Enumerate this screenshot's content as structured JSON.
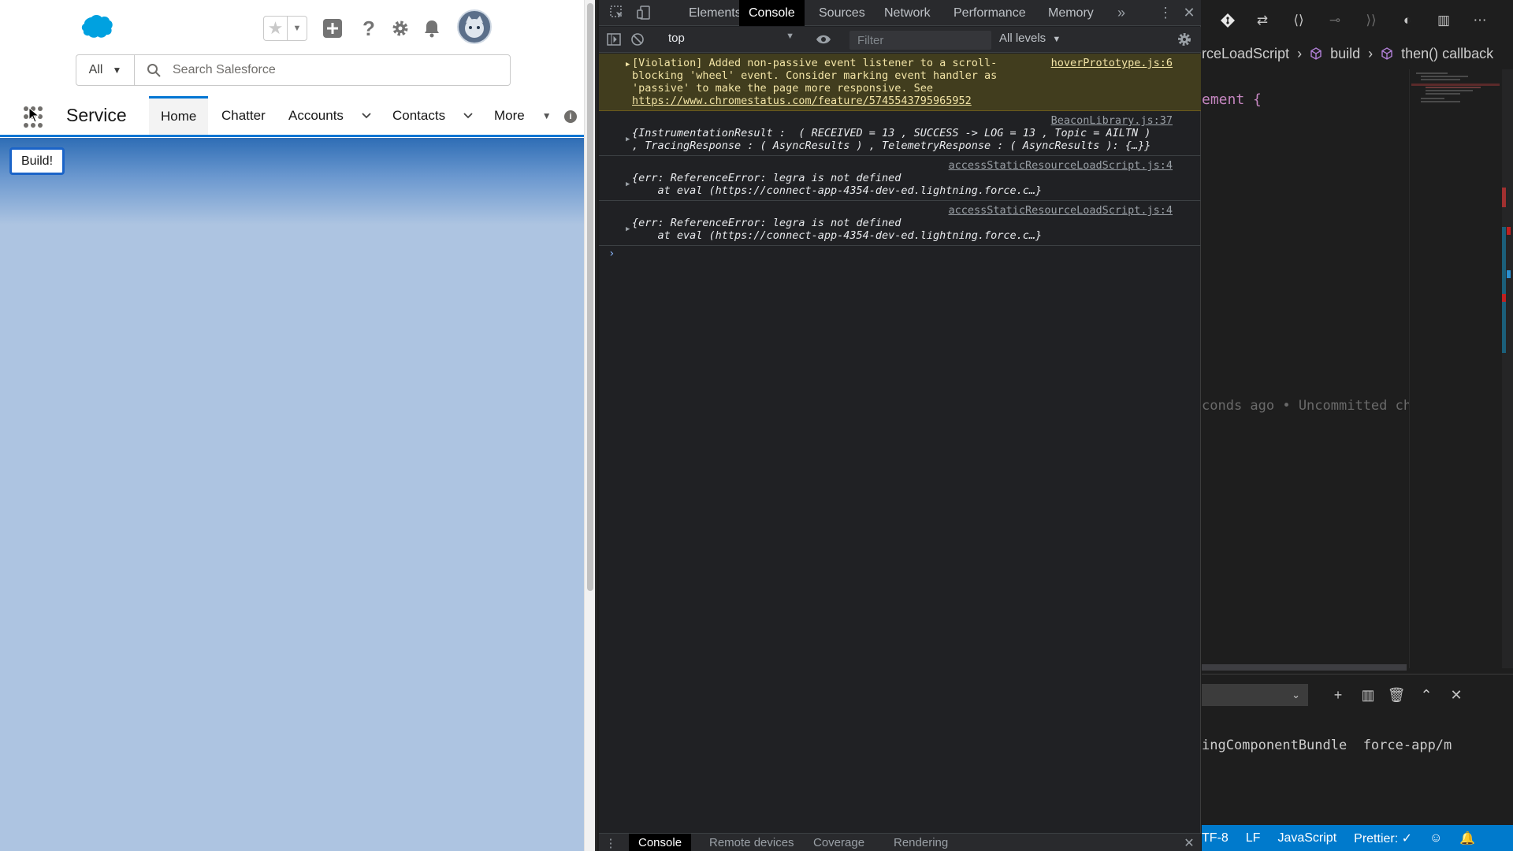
{
  "salesforce": {
    "search": {
      "scope": "All",
      "placeholder": "Search Salesforce"
    },
    "app_name": "Service",
    "tabs": [
      {
        "label": "Home",
        "active": true
      },
      {
        "label": "Chatter"
      },
      {
        "label": "Accounts"
      },
      {
        "label": "Contacts"
      },
      {
        "label": "More"
      }
    ],
    "build_button": "Build!",
    "colors": {
      "brand": "#0176d3",
      "banner": "#2e6db5",
      "body": "#adc4e1"
    }
  },
  "devtools": {
    "tabs": [
      "Elements",
      "Console",
      "Sources",
      "Network",
      "Performance",
      "Memory"
    ],
    "active_tab": "Console",
    "context": "top",
    "filter_placeholder": "Filter",
    "levels": "All levels",
    "messages": [
      {
        "type": "warning",
        "source": "hoverPrototype.js:6",
        "text": "[Violation] Added non-passive event listener to a scroll-blocking 'wheel' event. Consider marking event handler as 'passive' to make the page more responsive. See ",
        "link": "https://www.chromestatus.com/feature/5745543795965952"
      },
      {
        "type": "log",
        "source": "BeaconLibrary.js:37",
        "line1": "{InstrumentationResult :  ( RECEIVED = 13 , SUCCESS -> LOG = 13 , Topic = AILTN )",
        "line2": ", TracingResponse : ( AsyncResults ) , TelemetryResponse : ( AsyncResults ): {…}}"
      },
      {
        "type": "log",
        "source": "accessStaticResourceLoadScript.js:4",
        "line1": "{err: ReferenceError: legra is not defined",
        "line2": "    at eval (https://connect-app-4354-dev-ed.lightning.force.c…}"
      },
      {
        "type": "log",
        "source": "accessStaticResourceLoadScript.js:4",
        "line1": "{err: ReferenceError: legra is not defined",
        "line2": "    at eval (https://connect-app-4354-dev-ed.lightning.force.c…}"
      }
    ],
    "drawer_tabs": [
      "Console",
      "Remote devices",
      "Coverage",
      "Rendering"
    ],
    "drawer_active": "Console"
  },
  "vscode": {
    "breadcrumb": [
      "rceLoadScript",
      "build",
      "then() callback"
    ],
    "code_line": "ement {",
    "ghost_text": "conds ago • Uncommitted ch",
    "terminal_line": "ingComponentBundle  force-app/m",
    "status": [
      "TF-8",
      "LF",
      "JavaScript",
      "Prettier: ✓"
    ],
    "colors": {
      "statusbar": "#007acc",
      "keyword": "#c586c0"
    }
  }
}
